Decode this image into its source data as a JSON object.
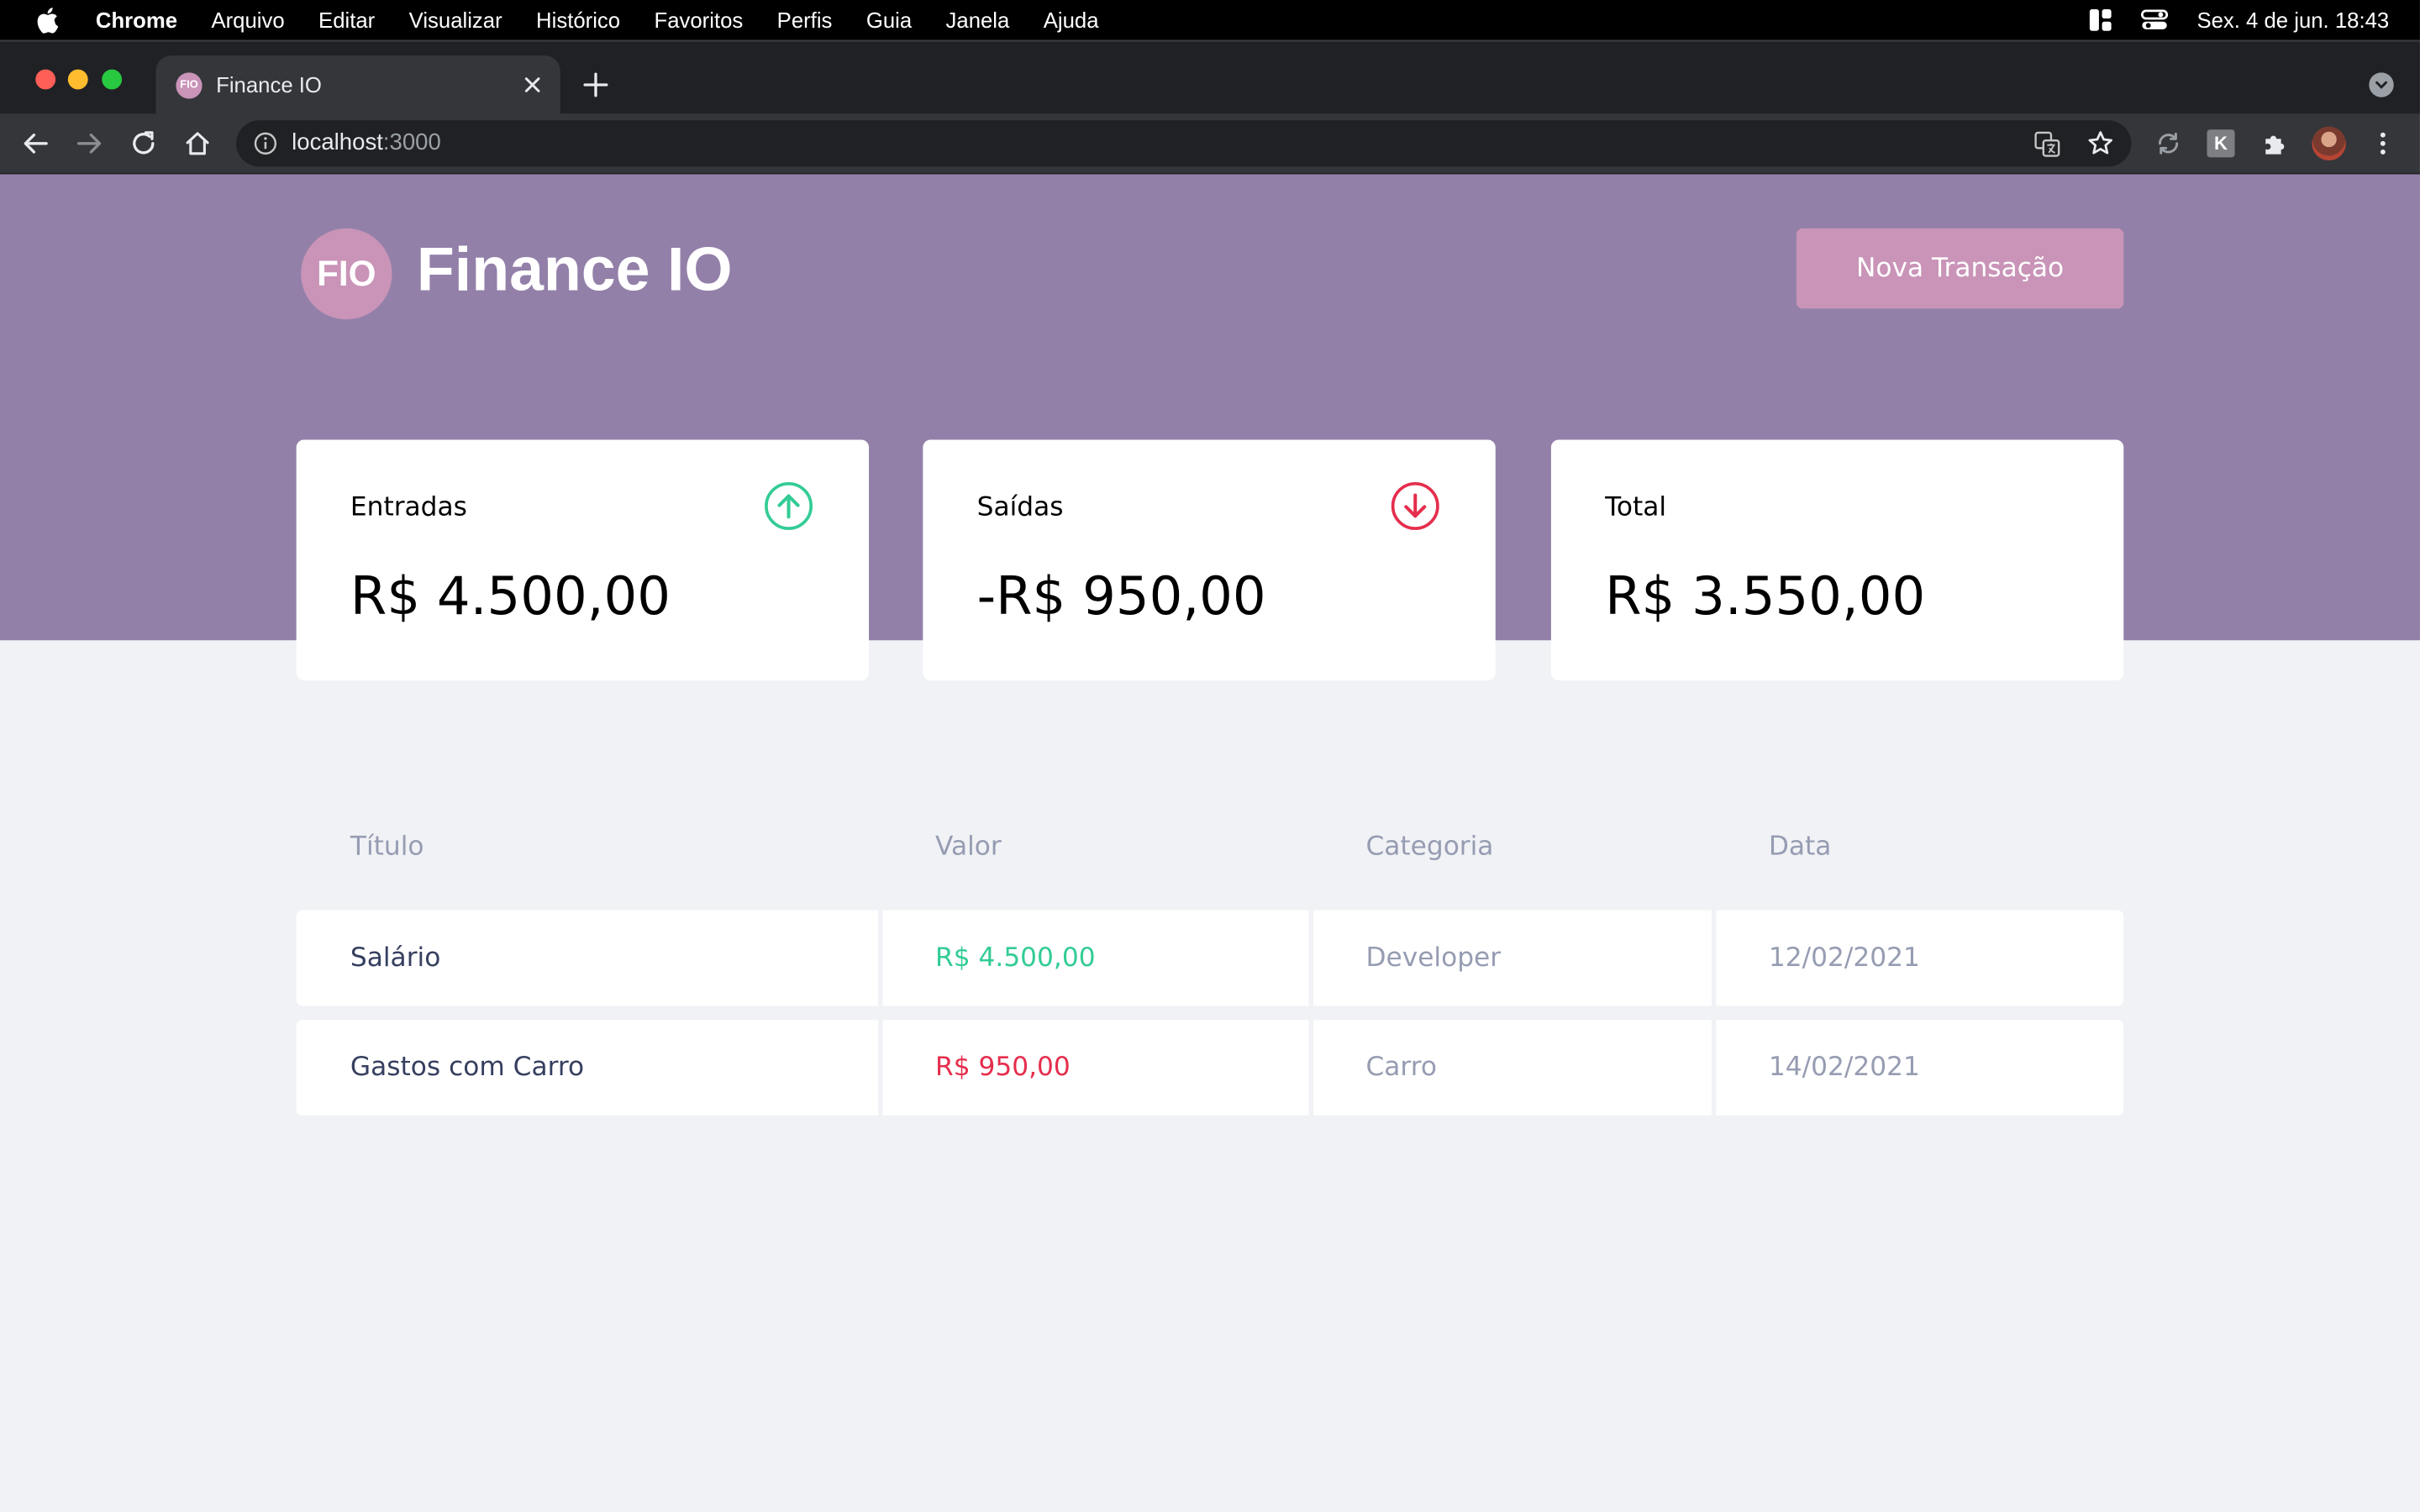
{
  "menubar": {
    "app_name": "Chrome",
    "items": [
      "Arquivo",
      "Editar",
      "Visualizar",
      "Histórico",
      "Favoritos",
      "Perfis",
      "Guia",
      "Janela",
      "Ajuda"
    ],
    "clock": "Sex. 4 de jun.  18:43"
  },
  "browser": {
    "tab": {
      "favicon_text": "FIO",
      "title": "Finance IO"
    },
    "omnibox": {
      "host": "localhost",
      "port": ":3000"
    },
    "extension_letter": "K"
  },
  "app": {
    "logo_text": "FIO",
    "title": "Finance IO",
    "new_transaction_label": "Nova Transação",
    "colors": {
      "header": "#9380a9",
      "accent": "#c994b8",
      "income": "#33cc95",
      "outcome": "#e52e4d",
      "text_muted": "#969cb2",
      "text_title": "#363f5f",
      "background": "#f0f2f5"
    }
  },
  "summary": {
    "income": {
      "label": "Entradas",
      "value": "R$ 4.500,00",
      "icon": "arrow-up-circle-icon"
    },
    "outcome": {
      "label": "Saídas",
      "value": "-R$ 950,00",
      "icon": "arrow-down-circle-icon"
    },
    "total": {
      "label": "Total",
      "value": "R$ 3.550,00"
    }
  },
  "transactions": {
    "headers": {
      "title": "Título",
      "amount": "Valor",
      "category": "Categoria",
      "date": "Data"
    },
    "rows": [
      {
        "title": "Salário",
        "amount": "R$ 4.500,00",
        "type": "income",
        "category": "Developer",
        "date": "12/02/2021"
      },
      {
        "title": "Gastos com Carro",
        "amount": "R$ 950,00",
        "type": "outcome",
        "category": "Carro",
        "date": "14/02/2021"
      }
    ]
  }
}
